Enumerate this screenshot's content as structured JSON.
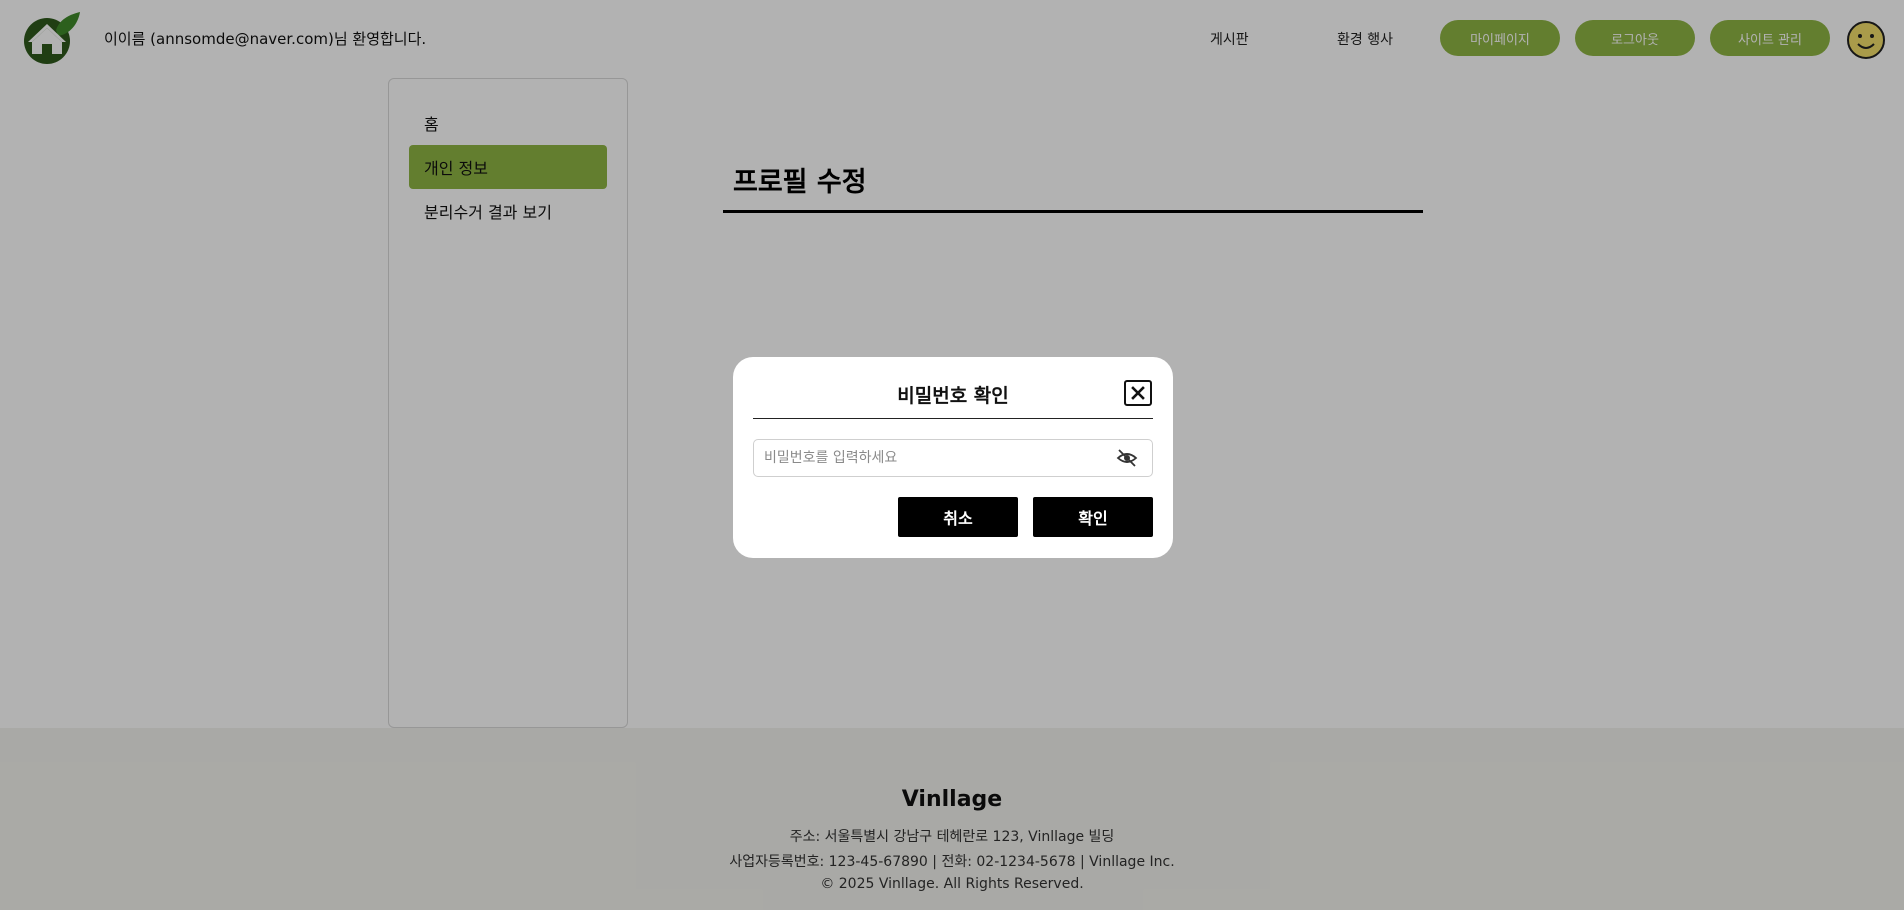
{
  "header": {
    "welcome_text": "이이름 (annsomde@naver.com)님 환영합니다.",
    "nav": {
      "board": "게시판",
      "events": "환경 행사"
    },
    "buttons": {
      "mypage": "마이페이지",
      "logout": "로그아웃",
      "admin": "사이트 관리"
    }
  },
  "sidebar": {
    "items": [
      {
        "label": "홈"
      },
      {
        "label": "개인 정보",
        "active": true
      },
      {
        "label": "분리수거 결과 보기"
      }
    ]
  },
  "main": {
    "title": "프로필 수정"
  },
  "modal": {
    "title": "비밀번호 확인",
    "password_placeholder": "비밀번호를 입력하세요",
    "password_value": "",
    "cancel_label": "취소",
    "confirm_label": "확인"
  },
  "footer": {
    "brand": "Vinllage",
    "address": "주소: 서울특별시 강남구 테헤란로 123, Vinllage 빌딩",
    "business": "사업자등록번호: 123-45-67890 | 전화: 02-1234-5678 | Vinllage Inc.",
    "copyright": "© 2025 Vinllage. All Rights Reserved."
  },
  "colors": {
    "accent_green": "#8fb544",
    "overlay": "rgba(0,0,0,0.30)",
    "button_black": "#000000"
  },
  "icons": {
    "logo": "house-leaf-logo",
    "avatar": "smiley-face-icon",
    "close": "close-icon",
    "visibility": "eye-off-icon"
  }
}
